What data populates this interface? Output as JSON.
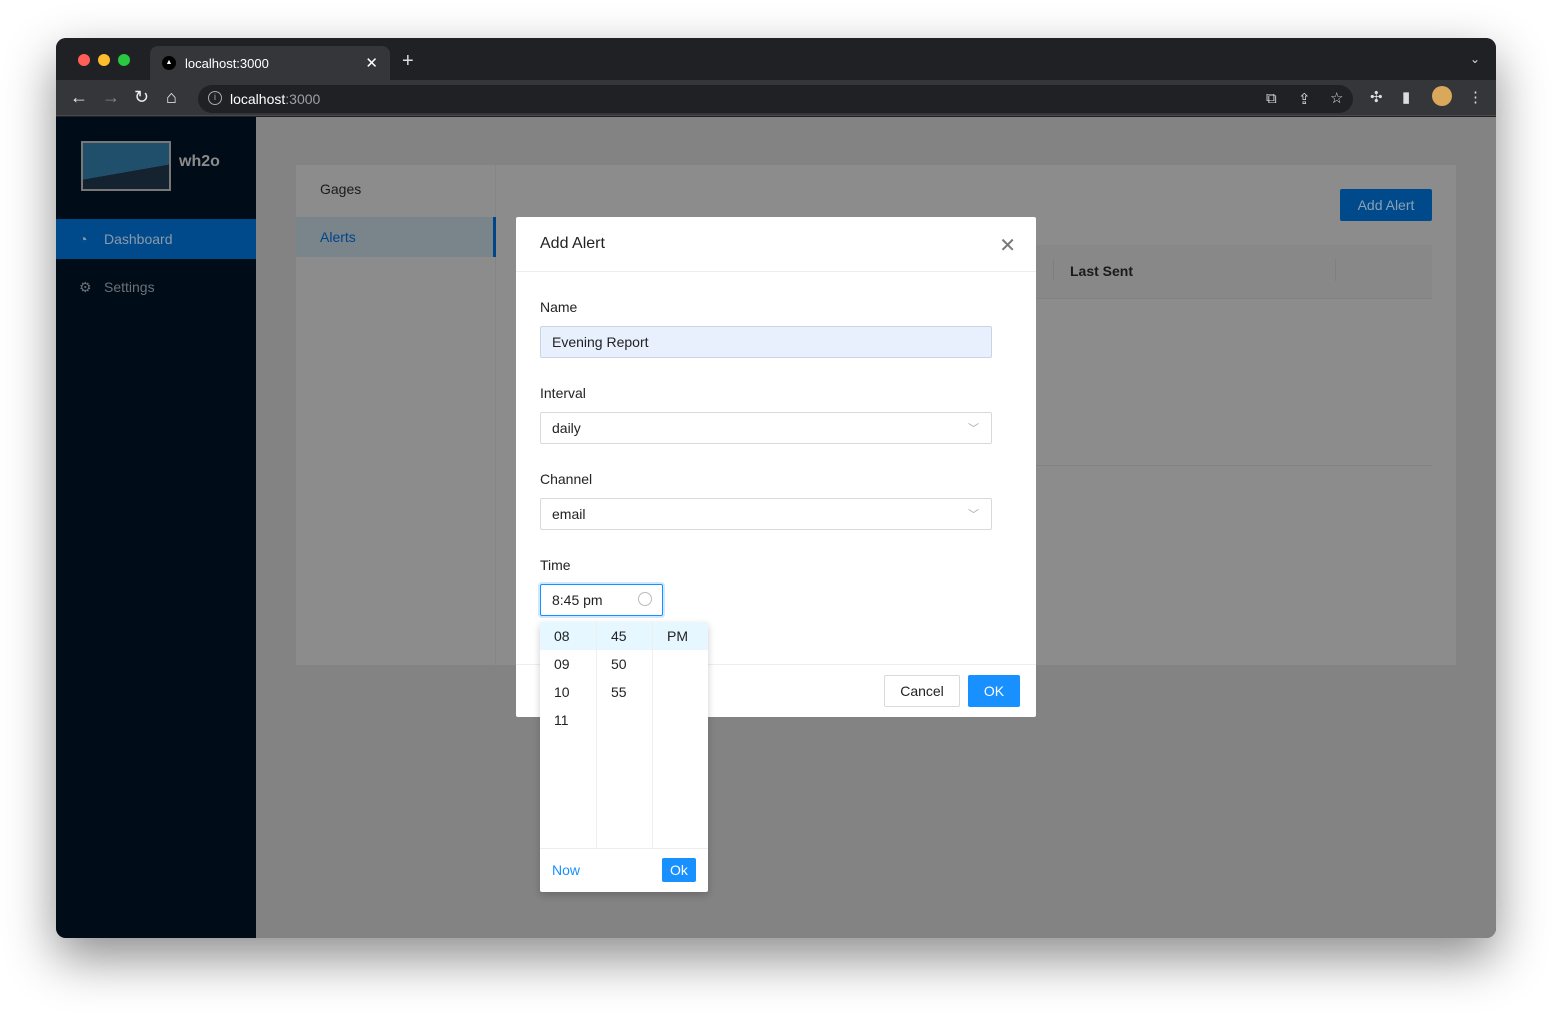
{
  "browser": {
    "tab_title": "localhost:3000",
    "url_host": "localhost",
    "url_port": ":3000"
  },
  "app": {
    "brand": "wh2o"
  },
  "sidebar": {
    "items": [
      {
        "label": "Dashboard",
        "icon": "dashboard-icon",
        "active": true
      },
      {
        "label": "Settings",
        "icon": "gear-icon",
        "active": false
      }
    ]
  },
  "subnav": {
    "items": [
      {
        "label": "Gages"
      },
      {
        "label": "Alerts",
        "active": true
      }
    ]
  },
  "main": {
    "add_alert_label": "Add Alert",
    "table": {
      "columns": [
        "Last Sent"
      ]
    }
  },
  "modal": {
    "title": "Add Alert",
    "name_label": "Name",
    "name_value": "Evening Report",
    "interval_label": "Interval",
    "interval_value": "daily",
    "channel_label": "Channel",
    "channel_value": "email",
    "time_label": "Time",
    "time_value": "8:45 pm",
    "cancel_label": "Cancel",
    "ok_label": "OK"
  },
  "time_picker": {
    "hours": [
      "08",
      "09",
      "10",
      "11"
    ],
    "minutes": [
      "45",
      "50",
      "55"
    ],
    "periods": [
      "PM"
    ],
    "selected": {
      "hour": "08",
      "minute": "45",
      "period": "PM"
    },
    "now_label": "Now",
    "ok_label": "Ok"
  },
  "colors": {
    "accent": "#1890ff",
    "sidebar": "#001529"
  }
}
